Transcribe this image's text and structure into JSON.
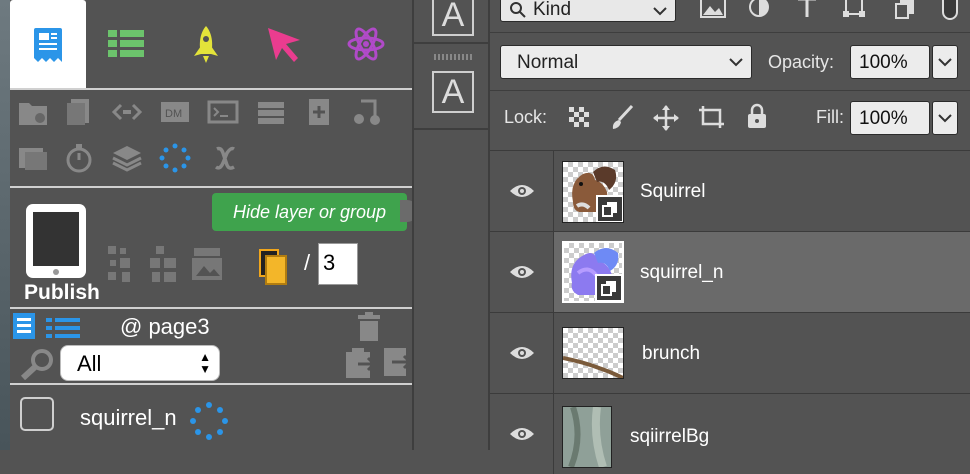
{
  "tools_panel": {
    "tooltip": "Hide layer or group",
    "publish_label": "Publish",
    "page_separator": "/",
    "page_total": "3",
    "page_name": "@ page3",
    "filter": {
      "selected": "All"
    },
    "layer_row": {
      "name": "squirrel_n"
    }
  },
  "strip": {
    "icon_letter": "A"
  },
  "layers_panel": {
    "filter_kind": "Kind",
    "blend_mode": "Normal",
    "opacity_label": "Opacity:",
    "opacity_value": "100%",
    "lock_label": "Lock:",
    "fill_label": "Fill:",
    "fill_value": "100%",
    "layers": [
      {
        "name": "Squirrel",
        "visible": true,
        "selected": false
      },
      {
        "name": "squirrel_n",
        "visible": true,
        "selected": true
      },
      {
        "name": "brunch",
        "visible": true,
        "selected": false
      },
      {
        "name": "sqiirrelBg",
        "visible": true,
        "selected": false
      }
    ]
  },
  "colors": {
    "tab_green": "#6cc36c",
    "tab_yellow": "#e3e33a",
    "tab_pink": "#ea3c8f",
    "tab_purple": "#b04ac8",
    "tooltip_bg": "#3fa34d",
    "accent_blue": "#2b95e8",
    "panel_bg": "#535353",
    "selected_row": "#6a6a6a"
  }
}
